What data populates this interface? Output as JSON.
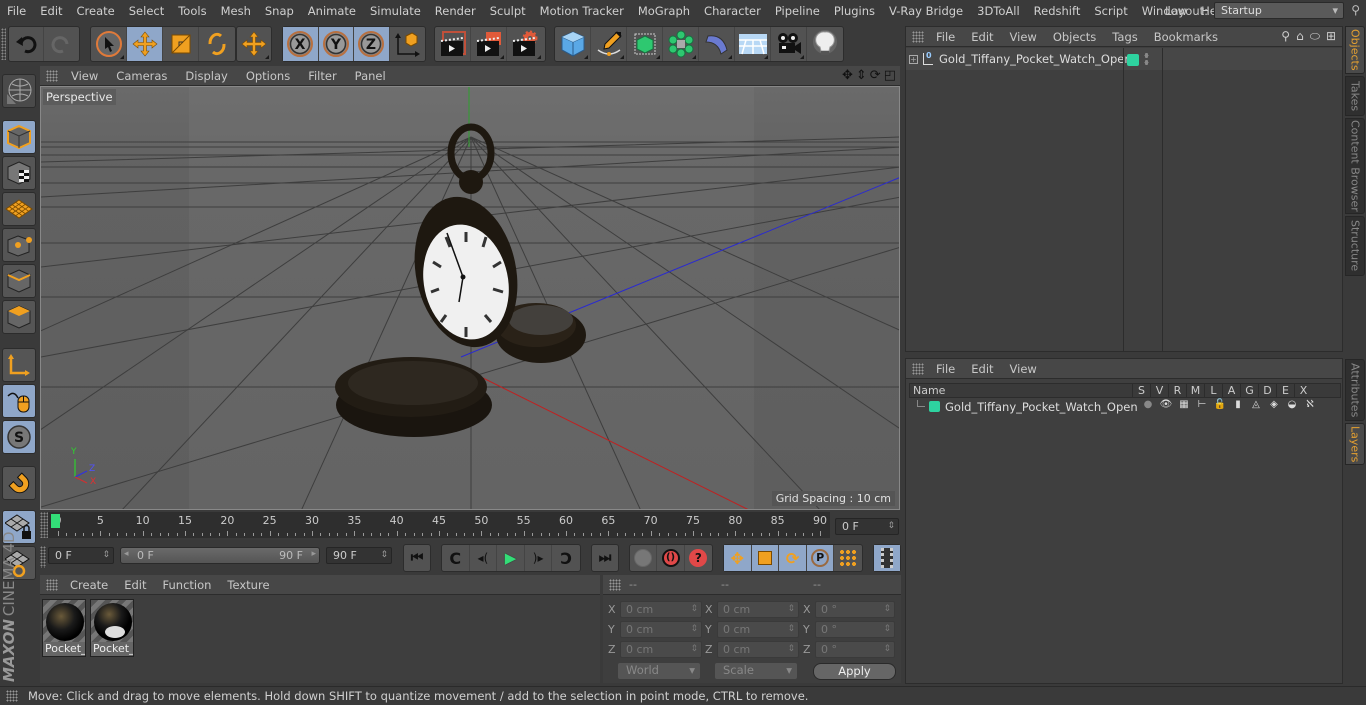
{
  "menubar": {
    "items": [
      "File",
      "Edit",
      "Create",
      "Select",
      "Tools",
      "Mesh",
      "Snap",
      "Animate",
      "Simulate",
      "Render",
      "Sculpt",
      "Motion Tracker",
      "MoGraph",
      "Character",
      "Pipeline",
      "Plugins",
      "V-Ray Bridge",
      "3DToAll",
      "Redshift",
      "Script",
      "Window",
      "Help"
    ],
    "layout_label": "Layout:",
    "layout_value": "Startup"
  },
  "toolbar": {
    "icons": [
      "undo-icon",
      "redo-icon",
      "live-selection-icon",
      "move-icon",
      "scale-icon",
      "rotate-icon",
      "transform-icon",
      "x-axis-icon",
      "y-axis-icon",
      "z-axis-icon",
      "coordinate-system-icon",
      "render-view-icon",
      "render-picture-viewer-icon",
      "render-settings-icon",
      "cube-icon",
      "pen-spline-icon",
      "subdivision-icon",
      "cloner-icon",
      "bend-deformer-icon",
      "floor-icon",
      "camera-icon",
      "light-icon"
    ]
  },
  "viewport": {
    "menu": [
      "View",
      "Cameras",
      "Display",
      "Options",
      "Filter",
      "Panel"
    ],
    "label": "Perspective",
    "grid_spacing": "Grid Spacing : 10 cm",
    "axis_labels": {
      "x": "X",
      "y": "Y",
      "z": "Z"
    }
  },
  "timeline": {
    "ticks": [
      "0",
      "5",
      "10",
      "15",
      "20",
      "25",
      "30",
      "35",
      "40",
      "45",
      "50",
      "55",
      "60",
      "65",
      "70",
      "75",
      "80",
      "85",
      "90"
    ],
    "current_frame": "0 F",
    "start_field": "0 F",
    "range_start": "0 F",
    "range_end": "90 F",
    "end_field": "90 F",
    "playhead_fraction": 0.0
  },
  "materials": {
    "menu": [
      "Create",
      "Edit",
      "Function",
      "Texture"
    ],
    "items": [
      {
        "label": "Pocket_W"
      },
      {
        "label": "Pocket_W"
      }
    ]
  },
  "coordinates": {
    "headers": [
      "--",
      "--",
      "--"
    ],
    "rows": [
      {
        "axis": "X",
        "pos": "0 cm",
        "size": "0 cm",
        "rot": "0 °"
      },
      {
        "axis": "Y",
        "pos": "0 cm",
        "size": "0 cm",
        "rot": "0 °"
      },
      {
        "axis": "Z",
        "pos": "0 cm",
        "size": "0 cm",
        "rot": "0 °"
      }
    ],
    "mode_dropdown": "World",
    "scale_dropdown": "Scale",
    "apply_label": "Apply"
  },
  "objects_panel": {
    "menu": [
      "File",
      "Edit",
      "View",
      "Objects",
      "Tags",
      "Bookmarks"
    ],
    "objects": [
      {
        "name": "Gold_Tiffany_Pocket_Watch_Open",
        "color": "#2ed3a0"
      }
    ]
  },
  "layers_panel": {
    "menu": [
      "File",
      "Edit",
      "View"
    ],
    "columns": [
      "Name",
      "S",
      "V",
      "R",
      "M",
      "L",
      "A",
      "G",
      "D",
      "E",
      "X"
    ],
    "layers": [
      {
        "name": "Gold_Tiffany_Pocket_Watch_Open",
        "color": "#2ed3a0"
      }
    ]
  },
  "side_tabs": {
    "top": [
      "Objects",
      "Takes",
      "Content Browser",
      "Structure"
    ],
    "bottom": [
      "Attributes",
      "Layers"
    ]
  },
  "branding": {
    "maxon": "MAXON",
    "product": "CINEMA 4D"
  },
  "status": "Move: Click and drag to move elements. Hold down SHIFT to quantize movement / add to the selection in point mode, CTRL to remove.",
  "colors": {
    "accent_blue": "#8fa7c9",
    "accent_orange": "#e6a130",
    "layer_green": "#2ed3a0",
    "timeline_green": "#33dd77"
  }
}
